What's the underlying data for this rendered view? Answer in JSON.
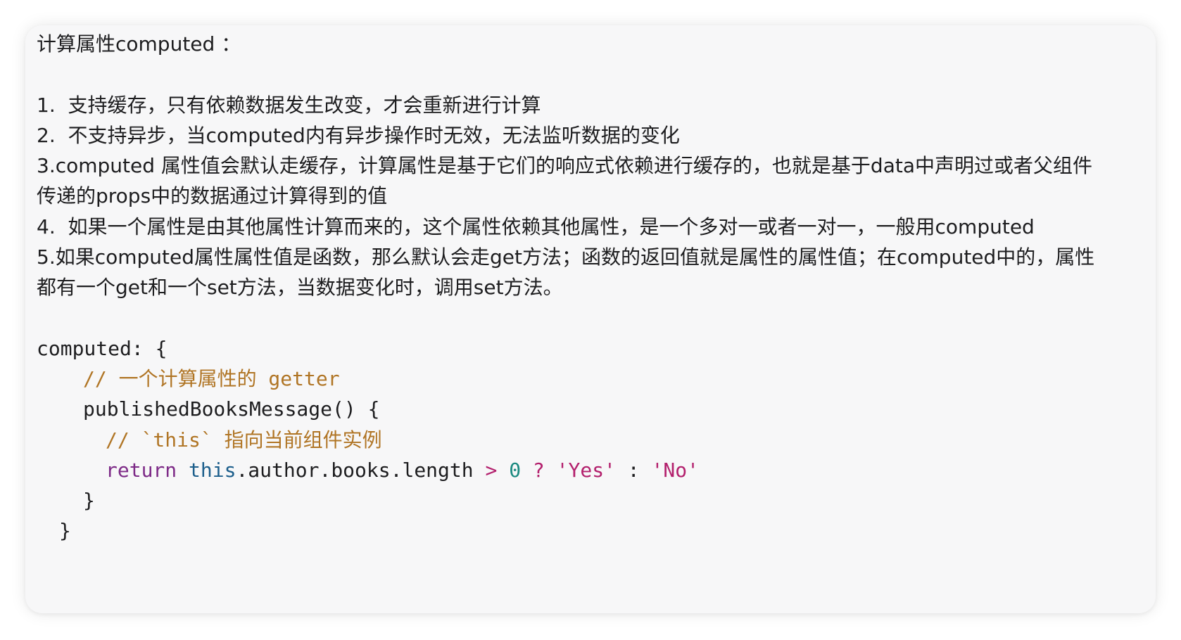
{
  "heading": "计算属性computed ：",
  "points": [
    "1.  支持缓存，只有依赖数据发生改变，才会重新进行计算",
    "2.  不支持异步，当computed内有异步操作时无效，无法监听数据的变化",
    "3.computed 属性值会默认走缓存，计算属性是基于它们的响应式依赖进行缓存的，也就是基于data中声明过或者父组件",
    "传递的props中的数据通过计算得到的值",
    "4.  如果一个属性是由其他属性计算而来的，这个属性依赖其他属性，是一个多对一或者一对一，一般用computed",
    "5.如果computed属性属性值是函数，那么默认会走get方法；函数的返回值就是属性的属性值；在computed中的，属性",
    "都有一个get和一个set方法，当数据变化时，调用set方法。"
  ],
  "code": {
    "line1": "computed: {",
    "comment1": "// 一个计算属性的 getter",
    "method": "publishedBooksMessage() {",
    "comment2": "// `this` 指向当前组件实例",
    "ret_kw": "return",
    "ret_this": "this",
    "ret_expr": ".author.books.length",
    "ret_gt": ">",
    "ret_zero": "0",
    "ret_q": "?",
    "ret_yes": "'Yes'",
    "ret_colon": ":",
    "ret_no": "'No'",
    "close_inner": "}",
    "close_outer": "}"
  },
  "colors": {
    "card_background": "#f7f7f8",
    "text": "#1d1d1f",
    "comment": "#b07525",
    "keyword": "#7d2a87",
    "this": "#1d5f8c",
    "number": "#1b8a80",
    "string": "#b3206d"
  }
}
